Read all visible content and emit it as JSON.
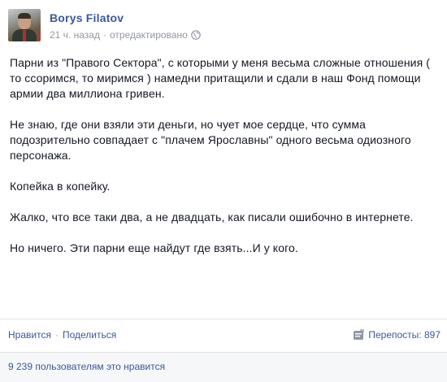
{
  "post": {
    "author": "Borys Filatov",
    "time": "21 ч. назад",
    "dot": "·",
    "edited": "отредактировано",
    "paragraphs": [
      "Парни из \"Правого Сектора\", с которыми у меня весьма сложные отношения ( то ссоримся, то миримся ) намедни притащили и сдали в наш Фонд помощи армии два миллиона гривен.",
      "Не знаю, где они взяли эти деньги, но чует мое сердце, что сумма подозрительно совпадает с \"плачем Ярославны\" одного весьма одиозного персонажа.",
      "Копейка в копейку.",
      "Жалко, что все таки два, а не двадцать, как писали ошибочно в интернете.",
      "Но ничего. Эти парни еще найдут где взять...И у кого."
    ]
  },
  "actions": {
    "like": "Нравится",
    "separator": "·",
    "share": "Поделиться",
    "reposts_label": "Перепосты: 897"
  },
  "likes": {
    "count_text": "9 239 пользователям это нравится"
  },
  "icons": {
    "globe": "globe-icon",
    "share": "share-icon"
  }
}
